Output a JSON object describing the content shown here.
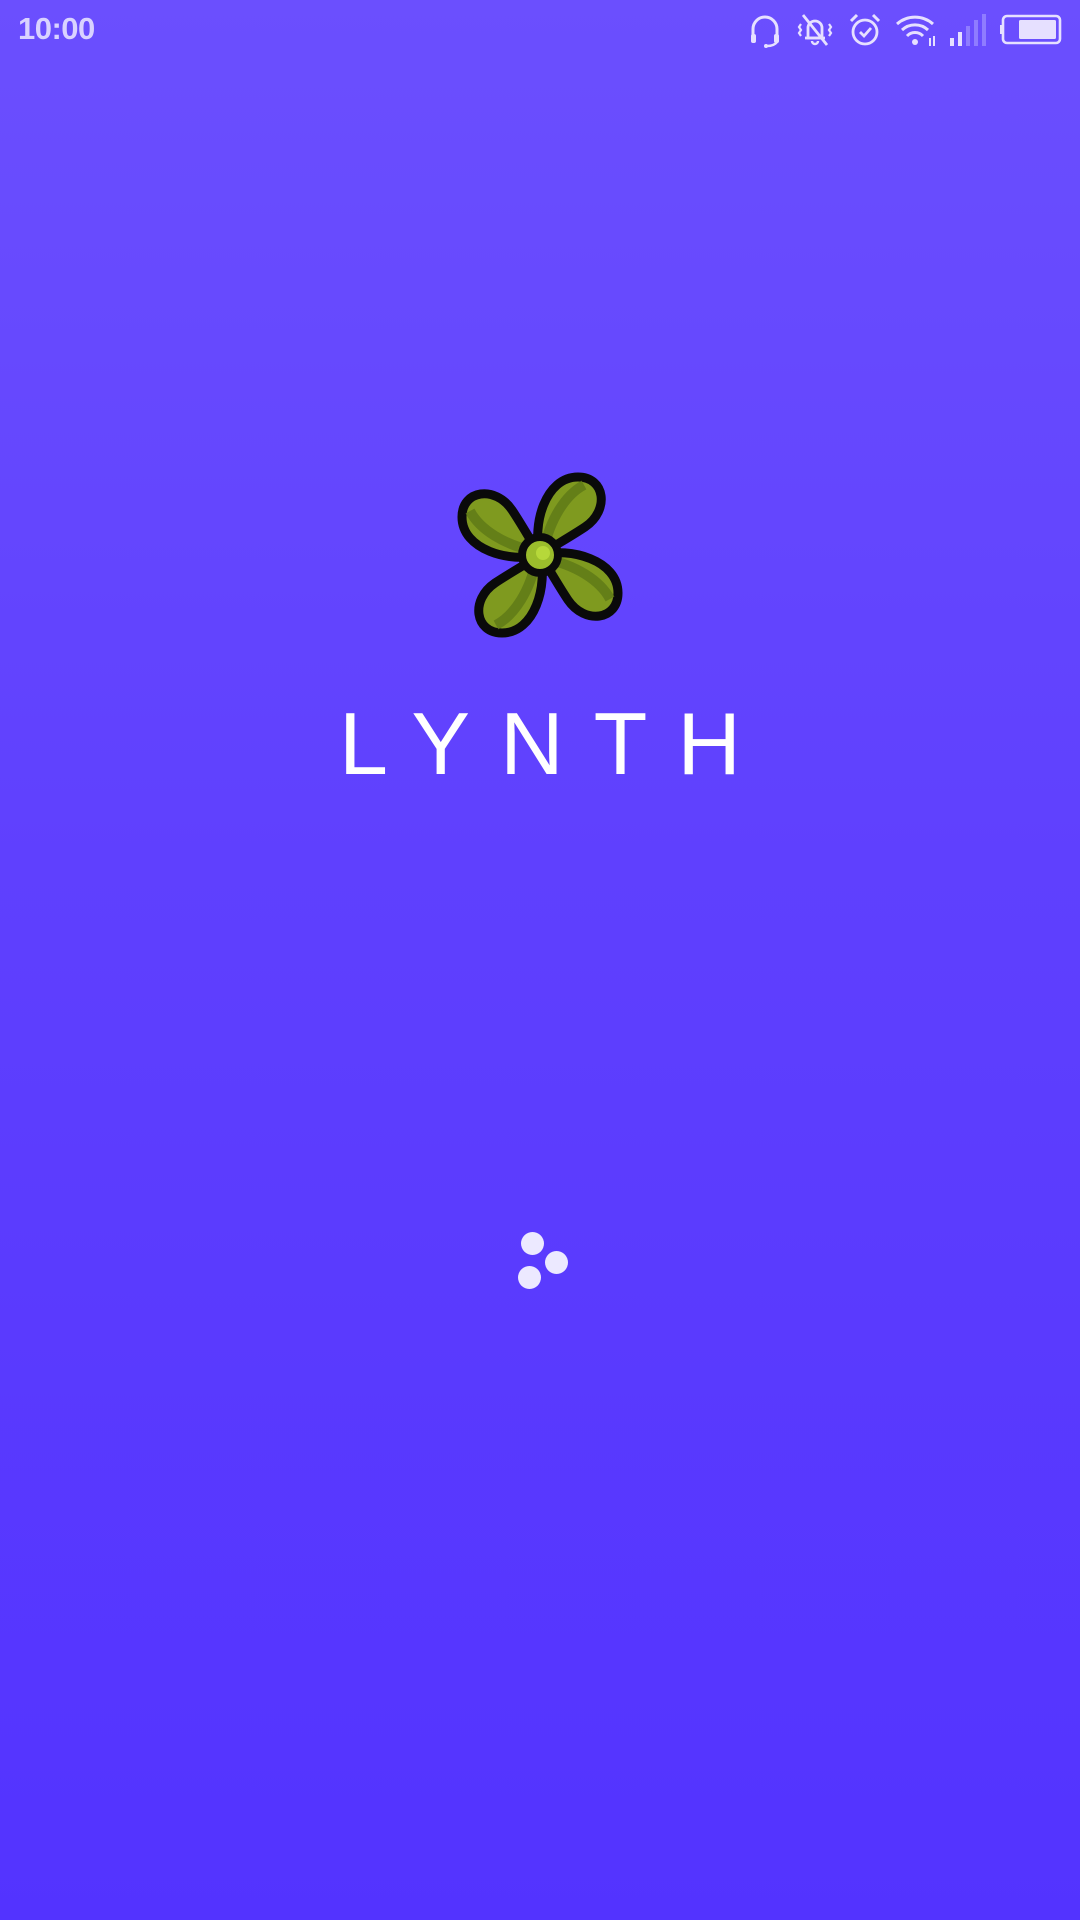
{
  "status_bar": {
    "time": "10:00",
    "icons": [
      "headset-icon",
      "vibrate-off-icon",
      "alarm-icon",
      "wifi-icon",
      "cellular-signal-icon",
      "battery-icon"
    ]
  },
  "splash": {
    "app_name": "LYNTH",
    "logo_icon": "propeller-logo-icon",
    "loading_indicator": "loading-spinner"
  },
  "colors": {
    "background_top": "#6b4ffe",
    "background_bottom": "#5333ff",
    "logo_green": "#7e9a1e",
    "text": "#ffffff"
  }
}
